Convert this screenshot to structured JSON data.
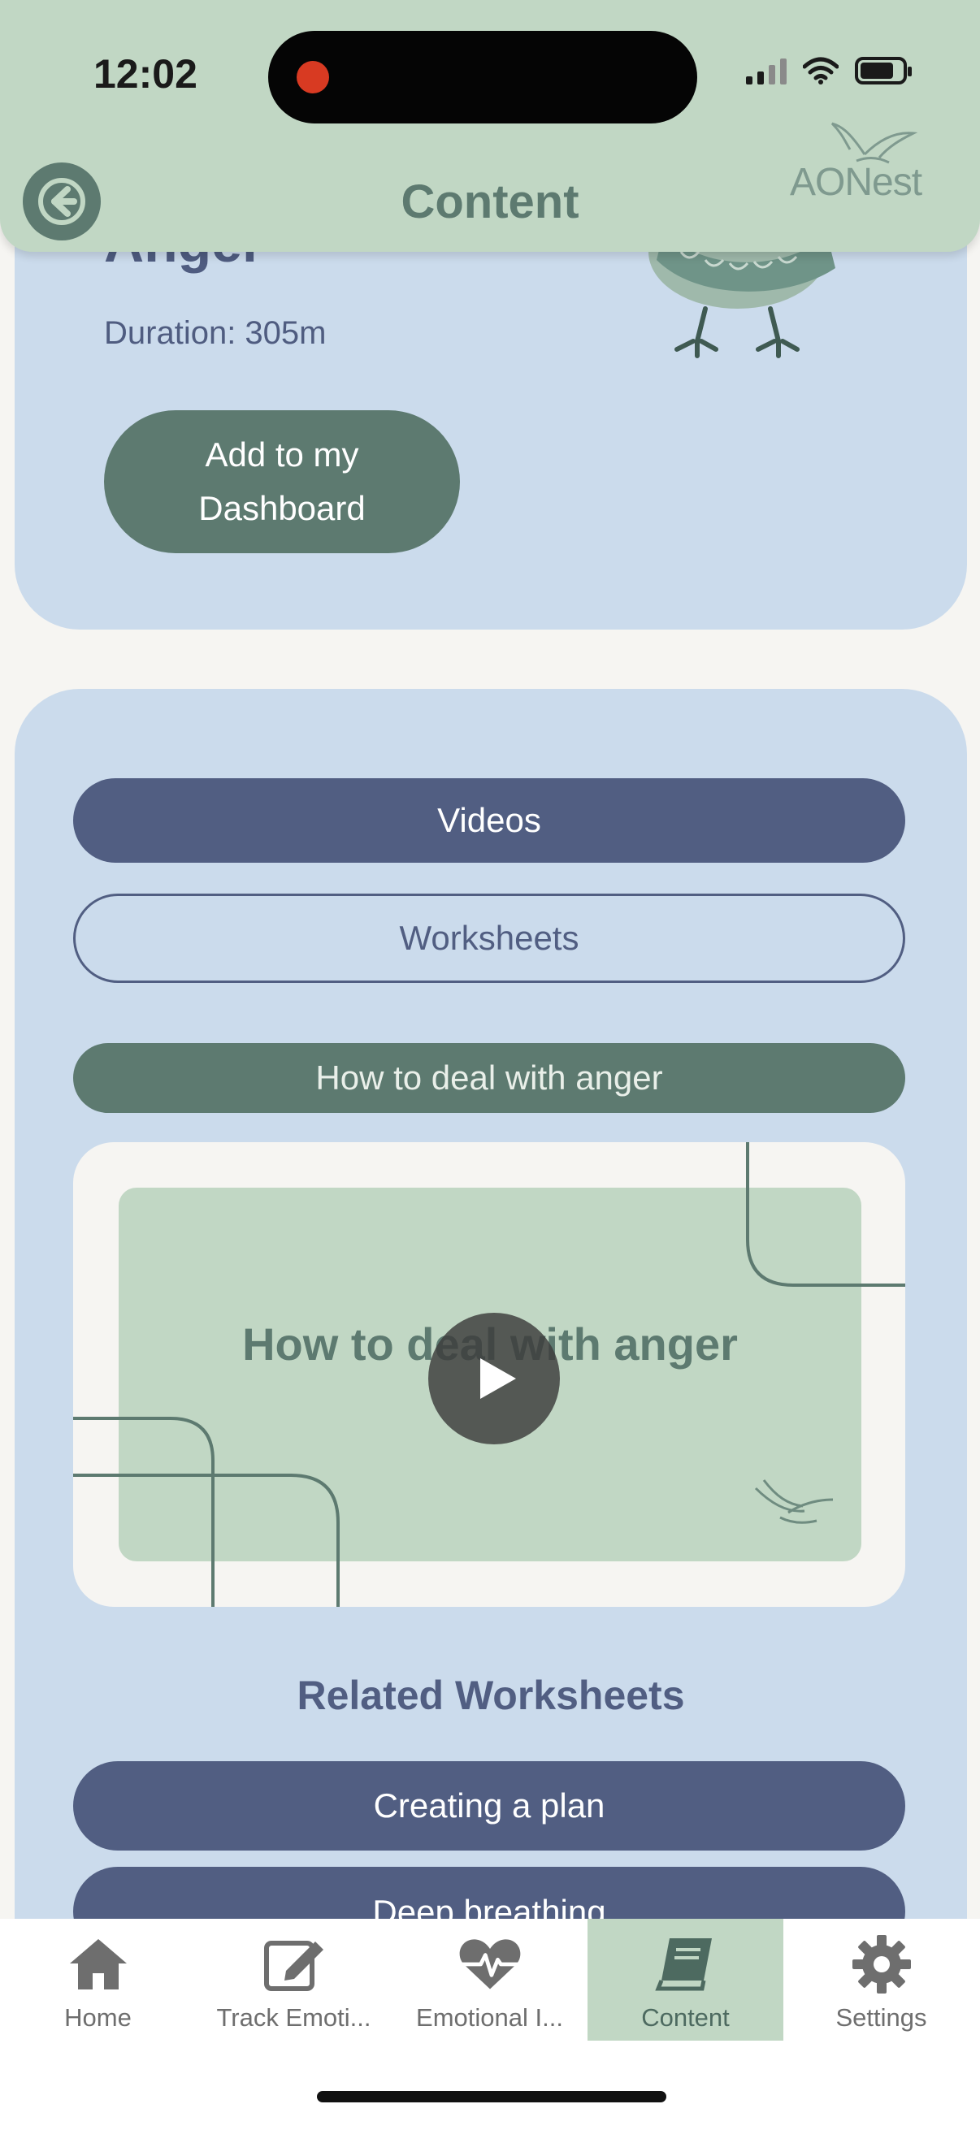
{
  "status_bar": {
    "time": "12:02"
  },
  "header": {
    "title": "Content",
    "brand": "AONest"
  },
  "course": {
    "title": "Anger",
    "duration": "Duration: 305m",
    "add_button": "Add to my Dashboard"
  },
  "media": {
    "tabs": {
      "videos": "Videos",
      "worksheets": "Worksheets"
    },
    "selected_video_title": "How to deal with anger",
    "thumbnail_text": "How to deal with anger",
    "related_heading": "Related Worksheets",
    "worksheets": [
      "Creating a plan",
      "Deep breathing"
    ]
  },
  "tabbar": {
    "items": [
      {
        "label": "Home",
        "icon": "home-icon"
      },
      {
        "label": "Track Emoti...",
        "icon": "edit-icon"
      },
      {
        "label": "Emotional I...",
        "icon": "heartbeat-icon"
      },
      {
        "label": "Content",
        "icon": "book-icon",
        "active": true
      },
      {
        "label": "Settings",
        "icon": "gear-icon"
      }
    ]
  },
  "colors": {
    "header_bg": "#c1d7c4",
    "card_bg": "#cbdbec",
    "accent_green": "#5d7a70",
    "accent_blue": "#515e82"
  }
}
